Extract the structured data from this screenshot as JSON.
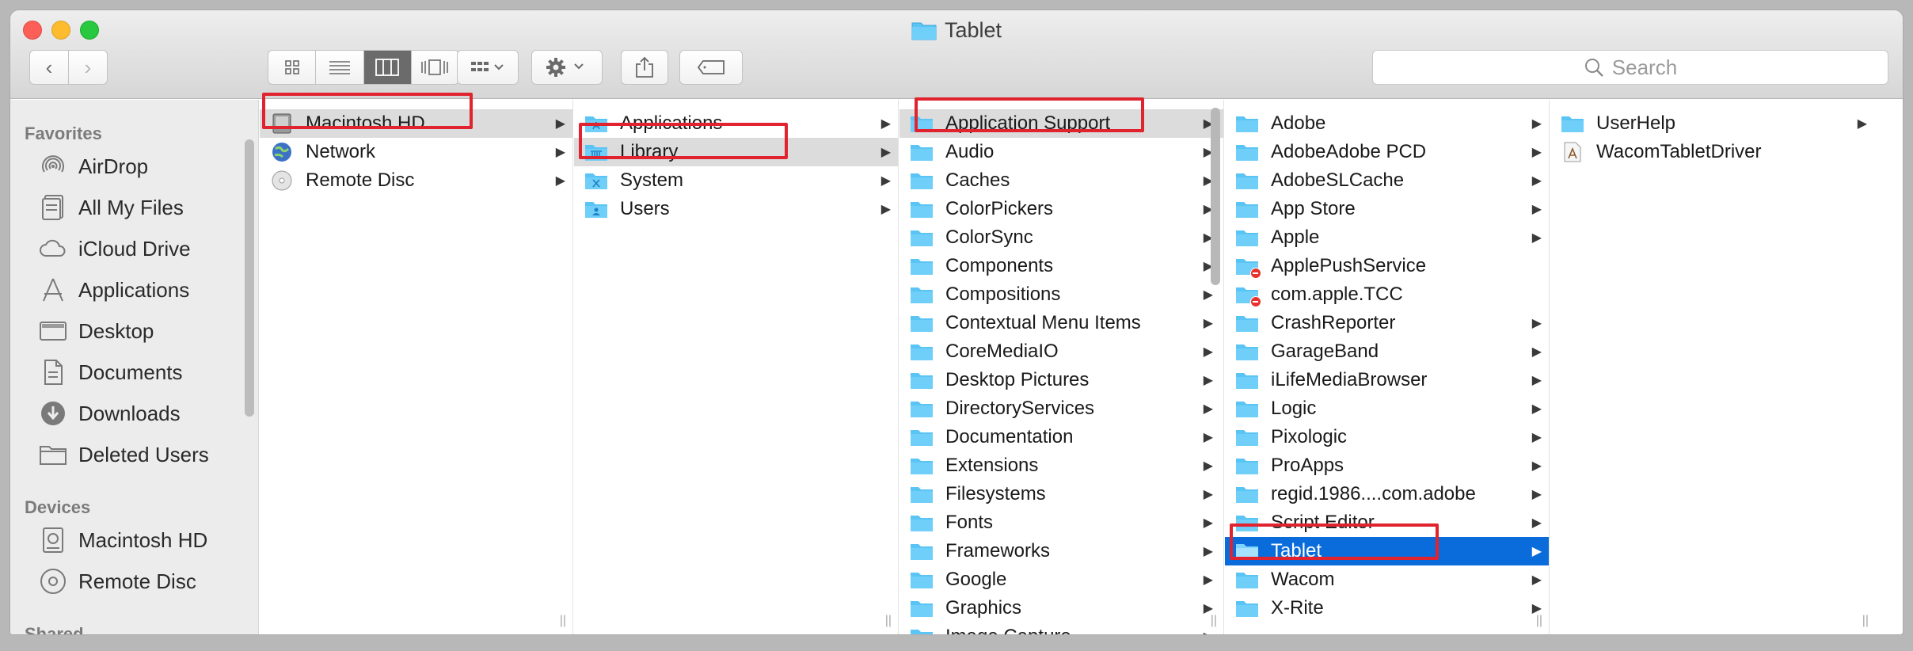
{
  "window": {
    "title": "Tablet"
  },
  "toolbar": {
    "back_label": "‹",
    "forward_label": "›",
    "search_placeholder": "Search"
  },
  "sidebar": {
    "favorites_heading": "Favorites",
    "favorites": [
      "AirDrop",
      "All My Files",
      "iCloud Drive",
      "Applications",
      "Desktop",
      "Documents",
      "Downloads",
      "Deleted Users"
    ],
    "devices_heading": "Devices",
    "devices": [
      "Macintosh HD",
      "Remote Disc"
    ],
    "shared_heading": "Shared"
  },
  "columns": {
    "col1": [
      "Macintosh HD",
      "Network",
      "Remote Disc"
    ],
    "col2": [
      "Applications",
      "Library",
      "System",
      "Users"
    ],
    "col3": [
      "Application Support",
      "Audio",
      "Caches",
      "ColorPickers",
      "ColorSync",
      "Components",
      "Compositions",
      "Contextual Menu Items",
      "CoreMediaIO",
      "Desktop Pictures",
      "DirectoryServices",
      "Documentation",
      "Extensions",
      "Filesystems",
      "Fonts",
      "Frameworks",
      "Google",
      "Graphics",
      "Image Capture"
    ],
    "col4": [
      "Adobe",
      "AdobeAdobe PCD",
      "AdobeSLCache",
      "App Store",
      "Apple",
      "ApplePushService",
      "com.apple.TCC",
      "CrashReporter",
      "GarageBand",
      "iLifeMediaBrowser",
      "Logic",
      "Pixologic",
      "ProApps",
      "regid.1986....com.adobe",
      "Script Editor",
      "Tablet",
      "Wacom",
      "X-Rite"
    ],
    "col5": [
      "UserHelp",
      "WacomTabletDriver"
    ]
  },
  "colors": {
    "selection_blue": "#0a6cdb",
    "highlight_red": "#e0232f",
    "folder_blue": "#5ac4f5"
  }
}
